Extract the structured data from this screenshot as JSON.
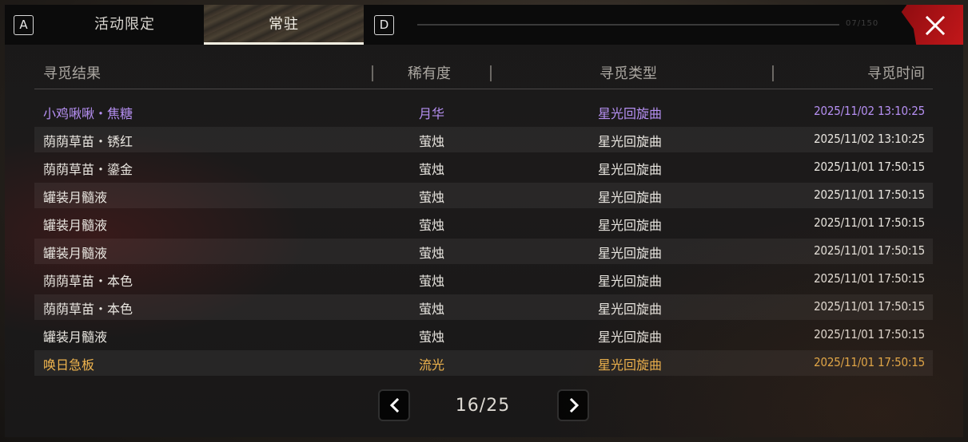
{
  "topbar": {
    "left_key": "A",
    "right_key": "D",
    "tabs": [
      {
        "label": "活动限定",
        "active": false
      },
      {
        "label": "常驻",
        "active": true
      }
    ],
    "progress_label": "07/150",
    "close_icon": "close-icon"
  },
  "table": {
    "headers": [
      "寻觅结果",
      "稀有度",
      "寻觅类型",
      "寻觅时间"
    ],
    "rows": [
      {
        "result": "小鸡啾啾・焦糖",
        "rarity": "月华",
        "type": "星光回旋曲",
        "time": "2025/11/02 13:10:25",
        "color": "#b690f3"
      },
      {
        "result": "荫荫草苗・锈红",
        "rarity": "萤烛",
        "type": "星光回旋曲",
        "time": "2025/11/02 13:10:25",
        "color": "#e9e6e0"
      },
      {
        "result": "荫荫草苗・鎏金",
        "rarity": "萤烛",
        "type": "星光回旋曲",
        "time": "2025/11/01 17:50:15",
        "color": "#e9e6e0"
      },
      {
        "result": "罐装月髓液",
        "rarity": "萤烛",
        "type": "星光回旋曲",
        "time": "2025/11/01 17:50:15",
        "color": "#e9e6e0"
      },
      {
        "result": "罐装月髓液",
        "rarity": "萤烛",
        "type": "星光回旋曲",
        "time": "2025/11/01 17:50:15",
        "color": "#e9e6e0"
      },
      {
        "result": "罐装月髓液",
        "rarity": "萤烛",
        "type": "星光回旋曲",
        "time": "2025/11/01 17:50:15",
        "color": "#e9e6e0"
      },
      {
        "result": "荫荫草苗・本色",
        "rarity": "萤烛",
        "type": "星光回旋曲",
        "time": "2025/11/01 17:50:15",
        "color": "#e9e6e0"
      },
      {
        "result": "荫荫草苗・本色",
        "rarity": "萤烛",
        "type": "星光回旋曲",
        "time": "2025/11/01 17:50:15",
        "color": "#e9e6e0"
      },
      {
        "result": "罐装月髓液",
        "rarity": "萤烛",
        "type": "星光回旋曲",
        "time": "2025/11/01 17:50:15",
        "color": "#e9e6e0"
      },
      {
        "result": "唤日急板",
        "rarity": "流光",
        "type": "星光回旋曲",
        "time": "2025/11/01 17:50:15",
        "color": "#f0b54e"
      }
    ]
  },
  "pager": {
    "page_label": "16/25",
    "prev_icon": "chevron-left-icon",
    "next_icon": "chevron-right-icon"
  },
  "colors": {
    "purple_rarity": "#b690f3",
    "gold_rarity": "#f0b54e",
    "close_red": "#c2171a"
  }
}
